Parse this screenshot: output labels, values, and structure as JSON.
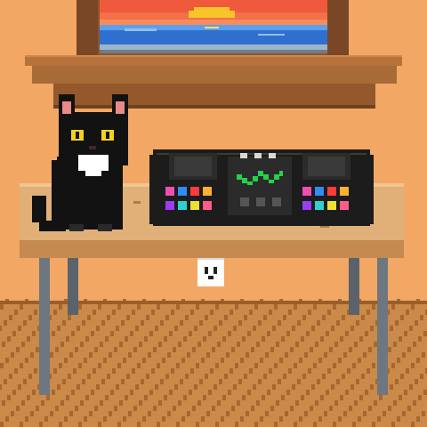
{
  "scene": {
    "description_free": true,
    "colors": {
      "wall": "#f2a765",
      "wall_shadow": "#e79a58",
      "wood_frame": "#8a5530",
      "wood_frame_dark": "#5e3519",
      "shelf": "#b8733c",
      "shelf_dark": "#7b4722",
      "sky_top": "#f05a3c",
      "sky_mid": "#f78c5a",
      "sun": "#f7c52a",
      "sea": "#2f6fcf",
      "sea_light": "#5aa0ee",
      "floor": "#c98a4a",
      "floor_stripe": "#a8672f",
      "table_top": "#e0b078",
      "table_edge": "#c48a4f",
      "table_leg": "#6e7680",
      "cat_body": "#121212",
      "cat_eye": "#f4d21c",
      "cat_ear_inner": "#e98a8a",
      "cat_chest": "#ffffff",
      "controller_body": "#1c1c1c",
      "controller_panel": "#2b2b2b",
      "controller_wave": "#27d04a",
      "pad_colors": [
        "#f04fb0",
        "#2f8cf0",
        "#ff3b3b",
        "#ffb02e",
        "#9b3cf0",
        "#2ed0d0",
        "#f0e02e",
        "#ff5a8a"
      ],
      "outlet_face": "#ffffff"
    },
    "items": {
      "window": "sunset-window-icon",
      "cat": "black-cat-icon",
      "controller": "dj-controller-icon",
      "outlet": "wall-outlet-icon",
      "table": "wooden-table-icon"
    }
  }
}
